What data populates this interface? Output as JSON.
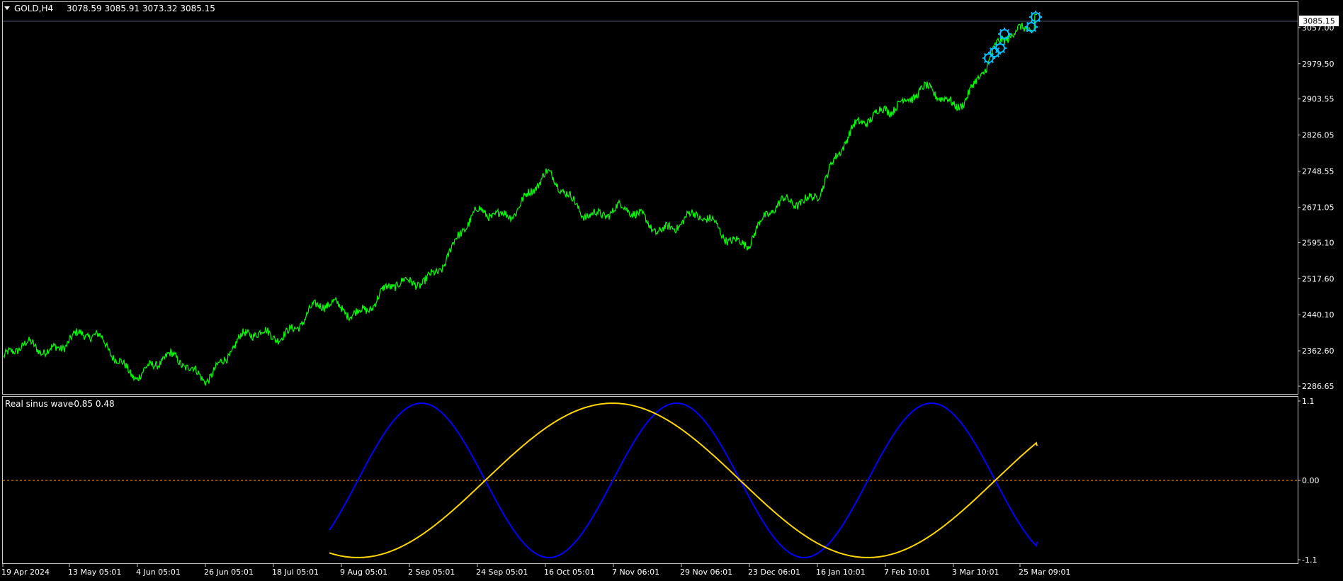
{
  "main_header": {
    "symbol": "GOLD,H4",
    "ohlc": "3078.59 3085.91 3073.32 3085.15"
  },
  "current_price_label": "3085.15",
  "indicator_header": {
    "name": "Real sinus wave",
    "values": "-0.85 0.48"
  },
  "colors": {
    "background": "#000000",
    "frame": "#c8c8c8",
    "price_line": "#00ff00",
    "current_price_line": "#4a5a7a",
    "signal_marker": "#00bfff",
    "sine": "#0000ff",
    "lead_sine": "#ffd700",
    "zero_line": "#ffa500",
    "axis_text": "#ffffff"
  },
  "chart_data": [
    {
      "type": "line",
      "title": "GOLD,H4",
      "series": [
        {
          "name": "GOLD,H4",
          "color": "#00ff00"
        }
      ],
      "x": [
        "19 Apr 2024",
        "13 May 05:01",
        "4 Jun 05:01",
        "26 Jun 05:01",
        "18 Jul 05:01",
        "9 Aug 05:01",
        "2 Sep 05:01",
        "24 Sep 05:01",
        "16 Oct 05:01",
        "7 Nov 06:01",
        "29 Nov 06:01",
        "23 Dec 06:01",
        "16 Jan 10:01",
        "7 Feb 10:01",
        "3 Mar 10:01",
        "25 Mar 09:01"
      ],
      "y": [
        2335,
        2400,
        2330,
        2325,
        2410,
        2455,
        2495,
        2640,
        2720,
        2650,
        2640,
        2610,
        2720,
        2905,
        2900,
        3085
      ],
      "y_ticks": [
        "3057.00",
        "2979.50",
        "2903.55",
        "2826.05",
        "2748.55",
        "2671.05",
        "2595.10",
        "2517.60",
        "2440.10",
        "2362.60",
        "2286.65"
      ],
      "ylim": [
        2270,
        3110
      ],
      "last_value": 3085.15,
      "markers": {
        "type": "signal",
        "color": "#00bfff",
        "count": 6
      }
    },
    {
      "type": "line",
      "title": "Real sinus wave",
      "series": [
        {
          "color": "#0000ff"
        },
        {
          "color": "#ffd700"
        }
      ],
      "y_ticks": [
        "1.1",
        "0.00",
        "-1.1"
      ],
      "ylim": [
        -1.1,
        1.1
      ],
      "zero_line": true,
      "last_values": [
        -0.85,
        0.48
      ]
    }
  ]
}
